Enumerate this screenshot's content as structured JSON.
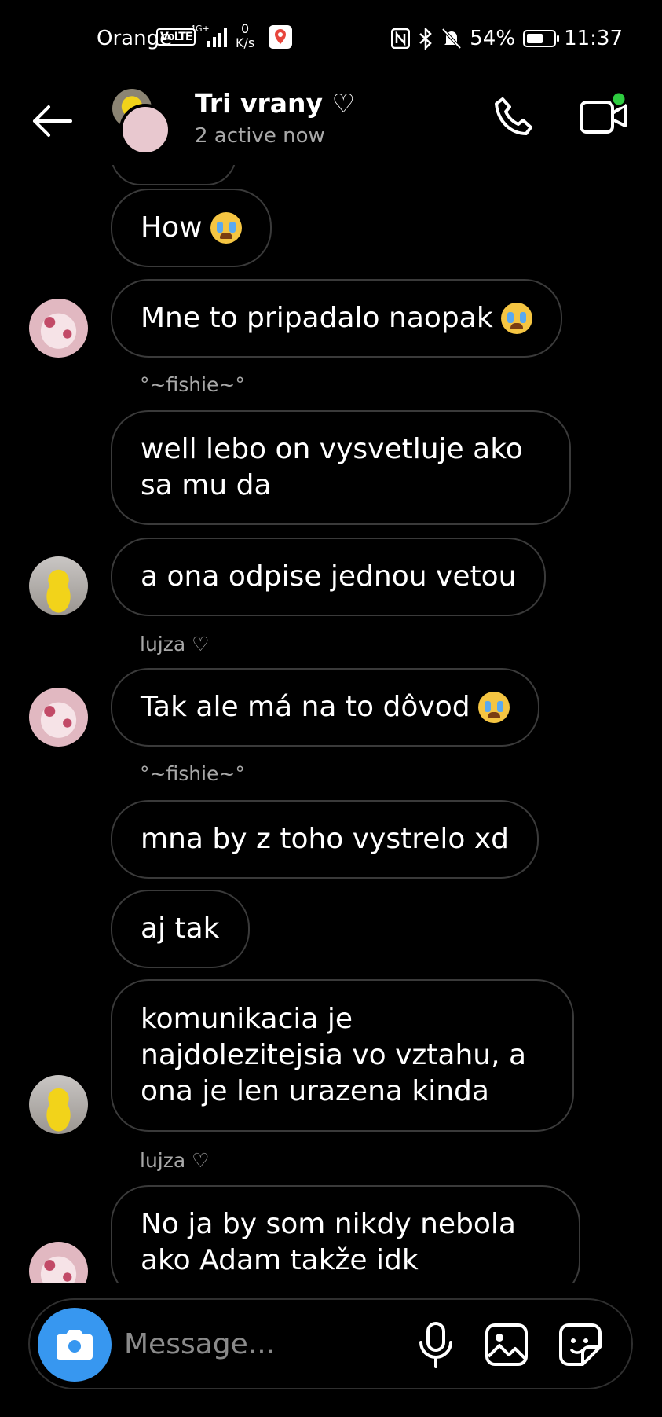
{
  "status_bar": {
    "carrier": "Orange",
    "volte": "VoLTE",
    "network": "4G+",
    "speed_value": "0",
    "speed_unit": "K/s",
    "battery": "54%",
    "time": "11:37"
  },
  "header": {
    "title": "Tri vrany ♡",
    "subtitle": "2 active now"
  },
  "messages": [
    {
      "text": "How"
    },
    {
      "text": "Mne to pripadalo naopak"
    },
    {
      "sender": "°~fishie~°"
    },
    {
      "text": "well lebo on vysvetluje ako sa mu da"
    },
    {
      "text": "a ona odpise jednou vetou"
    },
    {
      "sender": "lujza ♡"
    },
    {
      "text": "Tak ale má na to dôvod"
    },
    {
      "sender": "°~fishie~°"
    },
    {
      "text": "mna by z toho vystrelo xd"
    },
    {
      "text": "aj tak"
    },
    {
      "text": "komunikacia je najdolezitejsia vo vztahu, a ona je len urazena kinda"
    },
    {
      "sender": "lujza ♡"
    },
    {
      "text": "No ja by som nikdy nebola ako Adam takže idk"
    }
  ],
  "composer": {
    "placeholder": "Message..."
  },
  "colors": {
    "background": "#000000",
    "bubble_border": "#3a3a3a",
    "camera_button": "#3797f0",
    "online_dot": "#2ecc40",
    "secondary_text": "#a8a8a8"
  }
}
